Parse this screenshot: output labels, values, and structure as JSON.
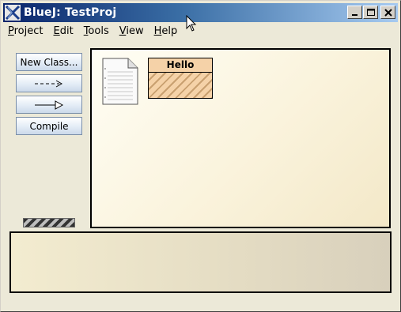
{
  "window": {
    "title": "BlueJ:  TestProj"
  },
  "menu": [
    {
      "underline": "P",
      "rest": "roject"
    },
    {
      "underline": "E",
      "rest": "dit"
    },
    {
      "underline": "T",
      "rest": "ools"
    },
    {
      "underline": "V",
      "rest": "iew"
    },
    {
      "underline": "H",
      "rest": "elp"
    }
  ],
  "sidebar": {
    "new_class": "New Class...",
    "compile": "Compile",
    "icons": [
      "dashed-uses-arrow-icon",
      "solid-inheritance-arrow-icon"
    ]
  },
  "diagram": {
    "classes": [
      {
        "name": "Hello"
      }
    ],
    "icons": [
      "readme-document-icon"
    ]
  },
  "colors": {
    "class_fill": "#f5d2a8",
    "canvas_bg": "#fffef5",
    "terminal_bg": "#e4dcc3",
    "title_gradient_start": "#0a246a"
  }
}
